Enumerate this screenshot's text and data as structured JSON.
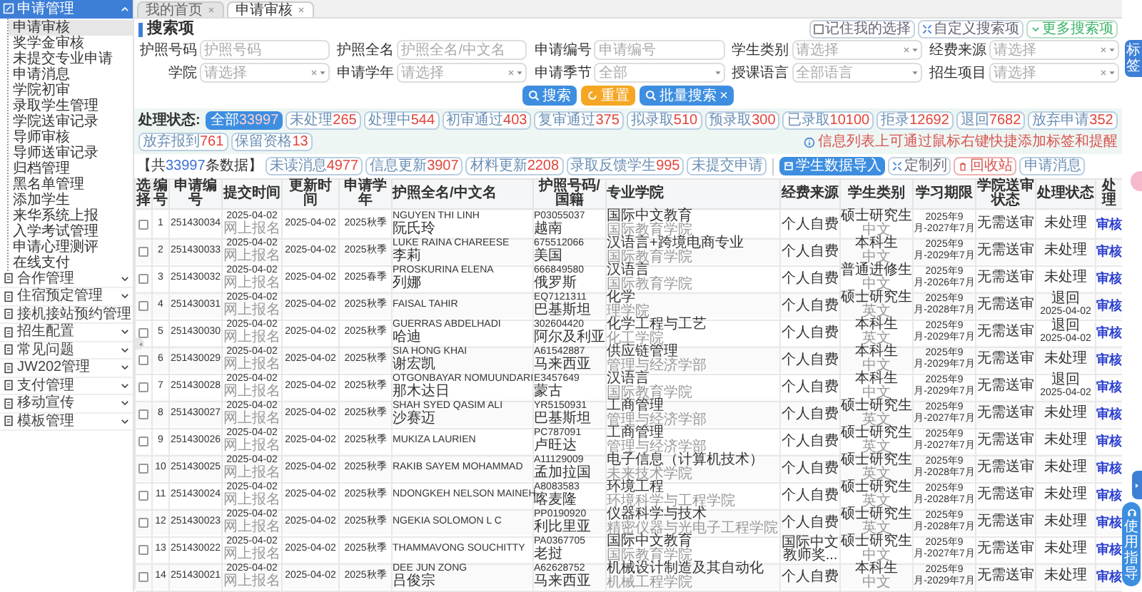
{
  "sidebar": {
    "sections": [
      {
        "label": "申请管理",
        "expanded": true,
        "items": [
          {
            "label": "申请审核",
            "selected": true
          },
          {
            "label": "奖学金审核",
            "selected": false
          },
          {
            "label": "未提交专业申请",
            "selected": false
          },
          {
            "label": "申请消息",
            "selected": false
          },
          {
            "label": "学院初审",
            "selected": false
          },
          {
            "label": "录取学生管理",
            "selected": false
          },
          {
            "label": "学院送审记录",
            "selected": false
          },
          {
            "label": "导师审核",
            "selected": false
          },
          {
            "label": "导师送审记录",
            "selected": false
          },
          {
            "label": "归档管理",
            "selected": false
          },
          {
            "label": "黑名单管理",
            "selected": false
          },
          {
            "label": "添加学生",
            "selected": false
          },
          {
            "label": "来华系统上报",
            "selected": false
          },
          {
            "label": "入学考试管理",
            "selected": false
          },
          {
            "label": "申请心理测评",
            "selected": false
          },
          {
            "label": "在线支付",
            "selected": false
          }
        ]
      },
      {
        "label": "合作管理",
        "expanded": false
      },
      {
        "label": "住宿预定管理",
        "expanded": false
      },
      {
        "label": "接机接站预约管理",
        "expanded": false
      },
      {
        "label": "招生配置",
        "expanded": false
      },
      {
        "label": "常见问题",
        "expanded": false
      },
      {
        "label": "JW202管理",
        "expanded": false
      },
      {
        "label": "支付管理",
        "expanded": false
      },
      {
        "label": "移动宣传",
        "expanded": false
      },
      {
        "label": "模板管理",
        "expanded": false
      }
    ]
  },
  "tabs": [
    {
      "label": "我的首页",
      "selected": false
    },
    {
      "label": "申请审核",
      "selected": true
    }
  ],
  "search_panel": {
    "title": "搜索项",
    "top_buttons": [
      {
        "kind": "checkbox",
        "label": "记住我的选择",
        "checked": false
      },
      {
        "kind": "custom",
        "label": "自定义搜索项"
      },
      {
        "kind": "more",
        "label": "更多搜索项"
      }
    ],
    "fields": [
      {
        "label": "护照号码",
        "kind": "text",
        "placeholder": "护照号码"
      },
      {
        "label": "护照全名",
        "kind": "text",
        "placeholder": "护照全名/中文名"
      },
      {
        "label": "申请编号",
        "kind": "text",
        "placeholder": "申请编号"
      },
      {
        "label": "学生类别",
        "kind": "select",
        "placeholder": "请选择",
        "clearable": true
      },
      {
        "label": "经费来源",
        "kind": "select",
        "placeholder": "请选择",
        "clearable": true
      },
      {
        "label": "学院",
        "kind": "select",
        "placeholder": "请选择",
        "clearable": true
      },
      {
        "label": "申请学年",
        "kind": "select",
        "placeholder": "请选择",
        "clearable": true
      },
      {
        "label": "申请季节",
        "kind": "select",
        "placeholder": "全部",
        "clearable": false
      },
      {
        "label": "授课语言",
        "kind": "select",
        "placeholder": "全部语言",
        "clearable": false
      },
      {
        "label": "招生项目",
        "kind": "select",
        "placeholder": "请选择",
        "clearable": true
      }
    ],
    "actions": [
      {
        "kind": "search",
        "label": "搜索"
      },
      {
        "kind": "reset",
        "label": "重置"
      },
      {
        "kind": "batch",
        "label": "批量搜索",
        "close": "×"
      }
    ]
  },
  "status_filter": {
    "label": "处理状态:",
    "options": [
      {
        "label": "全部",
        "count": "33997",
        "selected": true
      },
      {
        "label": "未处理",
        "count": "265",
        "selected": false
      },
      {
        "label": "处理中",
        "count": "544",
        "selected": false
      },
      {
        "label": "初审通过",
        "count": "403",
        "selected": false
      },
      {
        "label": "复审通过",
        "count": "375",
        "selected": false
      },
      {
        "label": "拟录取",
        "count": "510",
        "selected": false
      },
      {
        "label": "预录取",
        "count": "300",
        "selected": false
      },
      {
        "label": "已录取",
        "count": "10100",
        "selected": false
      },
      {
        "label": "拒录",
        "count": "12692",
        "selected": false
      },
      {
        "label": "退回",
        "count": "7682",
        "selected": false
      },
      {
        "label": "放弃申请",
        "count": "352",
        "selected": false
      },
      {
        "label": "放弃报到",
        "count": "761",
        "selected": false
      },
      {
        "label": "保留资格",
        "count": "13",
        "selected": false
      }
    ]
  },
  "toolbar": {
    "total": {
      "prefix": "【共",
      "count": "33997",
      "suffix": "条数据】"
    },
    "tags": [
      {
        "label": "未读消息",
        "count": "4977"
      },
      {
        "label": "信息更新",
        "count": "3907"
      },
      {
        "label": "材料更新",
        "count": "2208"
      },
      {
        "label": "录取反馈学生",
        "count": "995"
      },
      {
        "label": "未提交申请"
      }
    ],
    "buttons": [
      {
        "kind": "import",
        "label": "学生数据导入"
      },
      {
        "kind": "columns",
        "label": "定制列"
      },
      {
        "kind": "trash",
        "label": "回收站"
      },
      {
        "kind": "plain",
        "label": "申请消息"
      }
    ],
    "hint": "信息列表上可通过鼠标右键快捷添加标签和提醒"
  },
  "table": {
    "columns": [
      "选择",
      "编号",
      "申请编号",
      "提交时间",
      "更新时间",
      "申请学年",
      "护照全名/中文名",
      "护照号码/国籍",
      "专业学院",
      "经费来源",
      "学生类别",
      "学习期限",
      "学院送审状态",
      "处理状态",
      "处理"
    ],
    "rows": [
      {
        "checked": false,
        "no": "1",
        "app_id": "251430034",
        "submitted": "2025-04-02",
        "channel": "网上报名",
        "updated": "2025-04-02",
        "term": "2025秋季",
        "name": "NGUYEN THI LINH",
        "cn_name": "阮氏玲",
        "passport": "P03055037",
        "country": "越南",
        "major": "国际中文教育",
        "college": "国际教育学院",
        "funding": "个人自费",
        "category": "硕士研究生",
        "language": "中文",
        "period": "2025年9月-2027年7月",
        "review": "无需送审",
        "status": "未处理",
        "action": "审核"
      },
      {
        "checked": false,
        "no": "2",
        "app_id": "251430033",
        "submitted": "2025-04-02",
        "channel": "网上报名",
        "updated": "2025-04-02",
        "term": "2025秋季",
        "name": "LUKE RAINA CHAREESE",
        "cn_name": "李莉",
        "passport": "675512066",
        "country": "美国",
        "major": "汉语言+跨境电商专业",
        "college": "国际教育学院",
        "funding": "个人自费",
        "category": "本科生",
        "language": "中文",
        "period": "2025年9月-2029年7月",
        "review": "无需送审",
        "status": "未处理",
        "action": "审核"
      },
      {
        "checked": false,
        "no": "3",
        "app_id": "251430032",
        "submitted": "2025-04-02",
        "channel": "网上报名",
        "updated": "2025-04-02",
        "term": "2025春季",
        "name": "PROSKURINA ELENA",
        "cn_name": "列娜",
        "passport": "666849580",
        "country": "俄罗斯",
        "major": "汉语言",
        "college": "国际教育学院",
        "funding": "个人自费",
        "category": "普通进修生",
        "language": "中文",
        "period": "2025年9月-2026年7月",
        "review": "无需送审",
        "status": "未处理",
        "action": "审核"
      },
      {
        "checked": false,
        "no": "4",
        "app_id": "251430031",
        "submitted": "2025-04-02",
        "channel": "网上报名",
        "updated": "2025-04-02",
        "term": "2025秋季",
        "name": "FAISAL TAHIR",
        "passport": "EQ7121311",
        "country": "巴基斯坦",
        "major": "化学",
        "college": "理学院",
        "funding": "个人自费",
        "category": "硕士研究生",
        "language": "英文",
        "period": "2025年9月-2028年7月",
        "review": "无需送审",
        "status": "退回",
        "status_date": "2025-04-02",
        "action": "审核"
      },
      {
        "checked": false,
        "no": "5",
        "app_id": "251430030",
        "submitted": "2025-04-02",
        "channel": "网上报名",
        "updated": "2025-04-02",
        "term": "2025秋季",
        "name": "GUERRAS ABDELHADI",
        "cn_name": "哈迪",
        "passport": "302604420",
        "country": "阿尔及利亚",
        "major": "化学工程与工艺",
        "college": "化工学院",
        "funding": "个人自费",
        "category": "本科生",
        "language": "英文",
        "period": "2025年9月-2029年7月",
        "review": "无需送审",
        "status": "退回",
        "status_date": "2025-04-02",
        "action": "审核"
      },
      {
        "checked": false,
        "no": "6",
        "app_id": "251430029",
        "submitted": "2025-04-02",
        "channel": "网上报名",
        "updated": "2025-04-02",
        "term": "2025秋季",
        "name": "SIA HONG KHAI",
        "cn_name": "谢宏凯",
        "passport": "A61542887",
        "country": "马来西亚",
        "major": "供应链管理",
        "college": "管理与经济学部",
        "funding": "个人自费",
        "category": "本科生",
        "language": "中文",
        "period": "2025年9月-2029年7月",
        "review": "无需送审",
        "status": "未处理",
        "action": "审核"
      },
      {
        "checked": false,
        "no": "7",
        "app_id": "251430028",
        "submitted": "2025-04-02",
        "channel": "网上报名",
        "updated": "2025-04-02",
        "term": "2025秋季",
        "name": "OTGONBAYAR NOMUUNDARI",
        "cn_name": "那木达日",
        "passport": "E3457649",
        "country": "蒙古",
        "major": "汉语言",
        "college": "国际教育学院",
        "funding": "个人自费",
        "category": "本科生",
        "language": "中文",
        "period": "2025年9月-2029年7月",
        "review": "无需送审",
        "status": "退回",
        "status_date": "2025-04-02",
        "action": "审核"
      },
      {
        "checked": false,
        "no": "8",
        "app_id": "251430027",
        "submitted": "2025-04-02",
        "channel": "网上报名",
        "updated": "2025-04-02",
        "term": "2025秋季",
        "name": "SHAH SYED QASIM ALI",
        "cn_name": "沙赛迈",
        "passport": "YR5150931",
        "country": "巴基斯坦",
        "major": "工商管理",
        "college": "管理与经济学部",
        "funding": "个人自费",
        "category": "硕士研究生",
        "language": "英文",
        "period": "2025年9月-2027年7月",
        "review": "无需送审",
        "status": "未处理",
        "action": "审核"
      },
      {
        "checked": false,
        "no": "9",
        "app_id": "251430026",
        "submitted": "2025-04-02",
        "channel": "网上报名",
        "updated": "2025-04-02",
        "term": "2025秋季",
        "name": "MUKIZA LAURIEN",
        "passport": "PC787091",
        "country": "卢旺达",
        "major": "工商管理",
        "college": "管理与经济学部",
        "funding": "个人自费",
        "category": "硕士研究生",
        "language": "英文",
        "period": "2025年9月-2027年7月",
        "review": "无需送审",
        "status": "未处理",
        "action": "审核"
      },
      {
        "checked": false,
        "no": "10",
        "app_id": "251430025",
        "submitted": "2025-04-02",
        "channel": "网上报名",
        "updated": "2025-04-02",
        "term": "2025秋季",
        "name": "RAKIB SAYEM MOHAMMAD",
        "passport": "A11129009",
        "country": "孟加拉国",
        "major": "电子信息（计算机技术）",
        "college": "未来技术学院",
        "funding": "个人自费",
        "category": "硕士研究生",
        "language": "英文",
        "period": "2025年9月-2028年7月",
        "review": "无需送审",
        "status": "未处理",
        "action": "审核"
      },
      {
        "checked": false,
        "no": "11",
        "app_id": "251430024",
        "submitted": "2025-04-02",
        "channel": "网上报名",
        "updated": "2025-04-02",
        "term": "2025秋季",
        "name": "NDONGKEH NELSON MAINEH",
        "passport": "A8083583",
        "country": "喀麦隆",
        "major": "环境工程",
        "college": "环境科学与工程学院",
        "funding": "个人自费",
        "category": "硕士研究生",
        "language": "英文",
        "period": "2025年9月-2028年7月",
        "review": "无需送审",
        "status": "未处理",
        "action": "审核"
      },
      {
        "checked": false,
        "no": "12",
        "app_id": "251430023",
        "submitted": "2025-04-02",
        "channel": "网上报名",
        "updated": "2025-04-02",
        "term": "2025秋季",
        "name": "NGEKIA SOLOMON L C",
        "passport": "PP0190920",
        "country": "利比里亚",
        "major": "仪器科学与技术",
        "college": "精密仪器与光电子工程学院",
        "funding": "个人自费",
        "category": "硕士研究生",
        "language": "英文",
        "period": "2025年9月-2028年7月",
        "review": "无需送审",
        "status": "未处理",
        "action": "审核"
      },
      {
        "checked": false,
        "no": "13",
        "app_id": "251430022",
        "submitted": "2025-04-02",
        "channel": "网上报名",
        "updated": "2025-04-02",
        "term": "2025秋季",
        "name": "THAMMAVONG SOUCHITTY",
        "passport": "PA0367705",
        "country": "老挝",
        "major": "国际中文教育",
        "college": "国际教育学院",
        "funding": "国际中文教师奖...",
        "category": "硕士研究生",
        "language": "中文",
        "period": "2025年9月-2027年7月",
        "review": "无需送审",
        "status": "未处理",
        "action": "审核"
      },
      {
        "checked": false,
        "no": "14",
        "app_id": "251430021",
        "submitted": "2025-04-02",
        "channel": "网上报名",
        "updated": "2025-04-02",
        "term": "2025秋季",
        "name": "DEE JUN ZONG",
        "cn_name": "吕俊宗",
        "passport": "A62628752",
        "country": "马来西亚",
        "major": "机械设计制造及其自动化",
        "college": "机械工程学院",
        "funding": "个人自费",
        "category": "本科生",
        "language": "中文",
        "period": "2025年9月-2029年7月",
        "review": "无需送审",
        "status": "未处理",
        "action": "审核"
      }
    ]
  },
  "side_tab": "标签",
  "guide_button": "使用指导"
}
